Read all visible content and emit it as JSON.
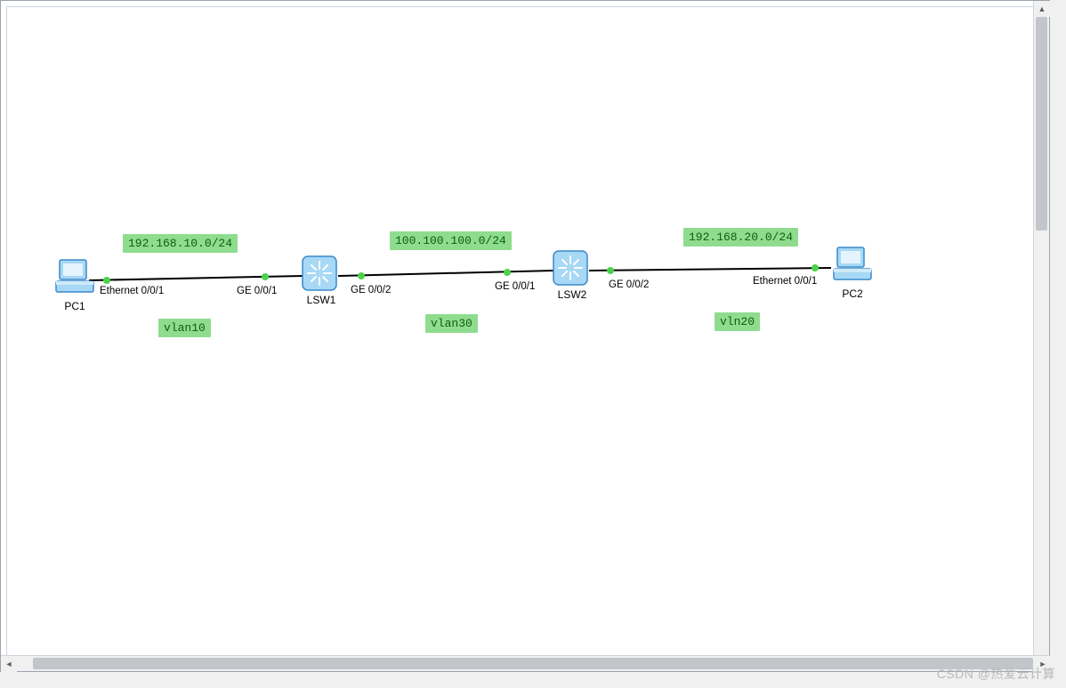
{
  "nodes": {
    "pc1": {
      "label": "PC1"
    },
    "lsw1": {
      "label": "LSW1"
    },
    "lsw2": {
      "label": "LSW2"
    },
    "pc2": {
      "label": "PC2"
    }
  },
  "subnets": {
    "left": "192.168.10.0/24",
    "middle": "100.100.100.0/24",
    "right": "192.168.20.0/24"
  },
  "vlans": {
    "left": "vlan10",
    "middle": "vlan30",
    "right": "vln20"
  },
  "interfaces": {
    "pc1_eth": "Ethernet 0/0/1",
    "lsw1_ge1": "GE 0/0/1",
    "lsw1_ge2": "GE 0/0/2",
    "lsw2_ge1": "GE 0/0/1",
    "lsw2_ge2": "GE 0/0/2",
    "pc2_eth": "Ethernet 0/0/1"
  },
  "watermark": "CSDN @热爱云计算",
  "icons": {
    "pc": "pc-icon",
    "switch": "switch-icon"
  },
  "colors": {
    "tag_bg": "#8fdc8f",
    "tag_fg": "#0b5f0b",
    "link_dot": "#4bd24b"
  }
}
